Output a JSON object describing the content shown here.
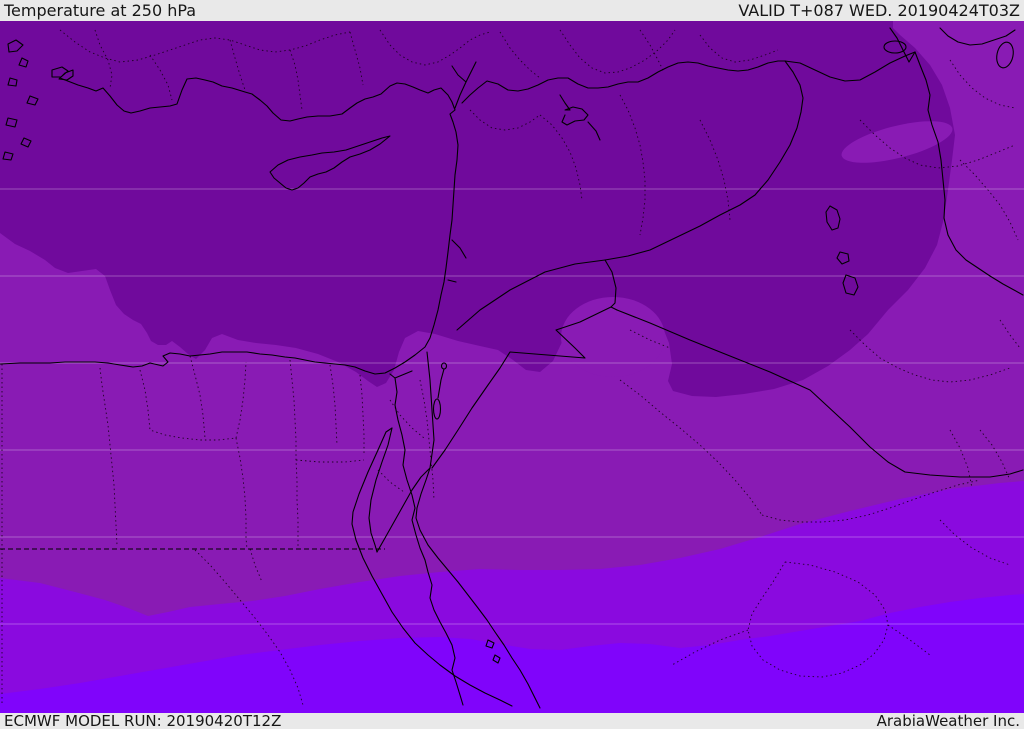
{
  "header": {
    "title": "Temperature at 250 hPa",
    "valid": "VALID T+087 WED. 20190424T03Z"
  },
  "footer": {
    "model_run": "ECMWF MODEL RUN: 20190420T12Z",
    "credit": "ArabiaWeather Inc."
  },
  "map": {
    "kind": "temperature shading map, Middle East / Eastern Mediterranean region",
    "colors": {
      "band_dark": "#700A9C",
      "band_medium": "#891BB4",
      "band_bright": "#8A0ADF",
      "band_violet": "#8004FB",
      "outline": "#000000",
      "gridline": "rgba(255,255,255,0.30)",
      "panel_bg": "#e9e9e9",
      "panel_text": "#161616"
    }
  }
}
